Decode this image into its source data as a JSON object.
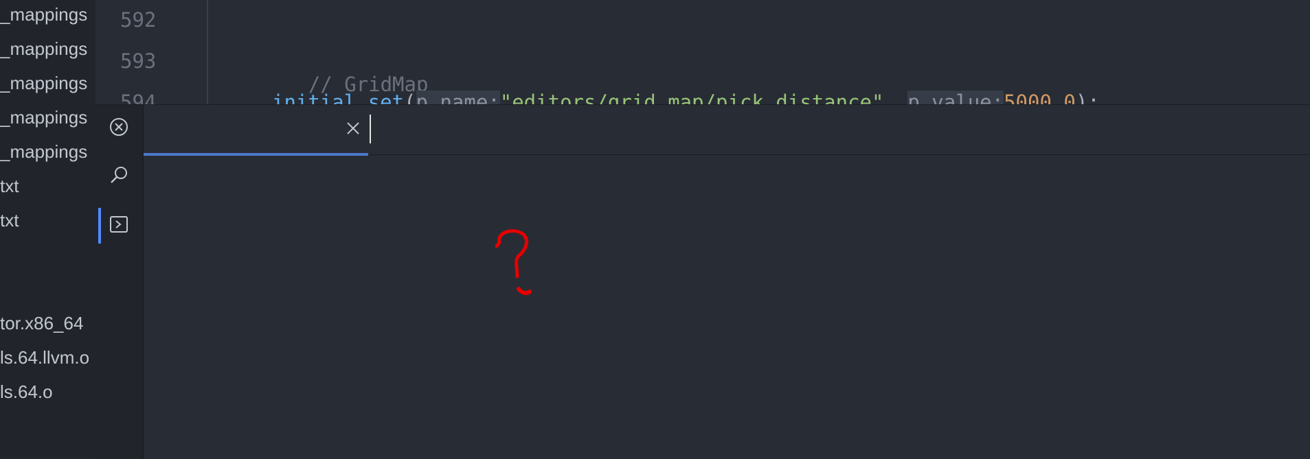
{
  "file_tree": {
    "items": [
      "_mappings",
      "_mappings",
      "_mappings",
      "_mappings",
      "_mappings",
      "txt",
      "txt",
      "tor.x86_64",
      "ls.64.llvm.o",
      "ls.64.o"
    ]
  },
  "editor": {
    "lines": [
      {
        "number": "592"
      },
      {
        "number": "593",
        "comment": "// GridMap"
      },
      {
        "number": "594",
        "fn_a": "initial",
        "fn_b": "set",
        "open": "(",
        "hint1": "p_name:",
        "str": "\"editors/grid_map/pick_distance\"",
        "comma": ", ",
        "hint2": "p_value:",
        "num": "5000.0",
        "close": ");"
      }
    ]
  },
  "bottom_panel": {
    "toolbar_icons": [
      "close-circle-icon",
      "search-icon",
      "terminal-icon"
    ],
    "tab_label": "",
    "annotation": "?"
  },
  "colors": {
    "accent": "#4d78cc",
    "annotation": "#e60000"
  }
}
